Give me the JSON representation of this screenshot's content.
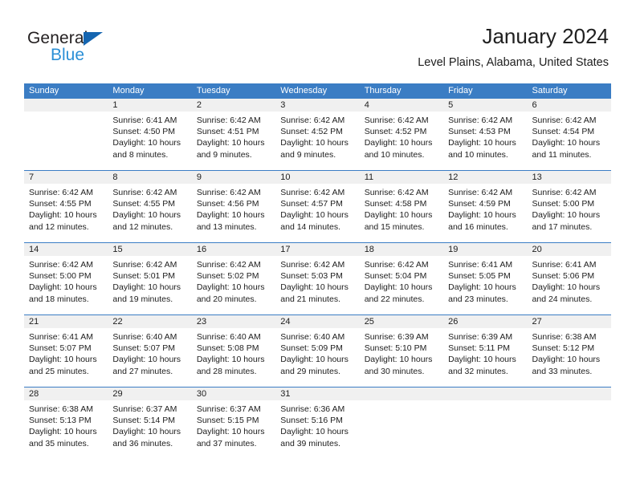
{
  "brand": {
    "name_top": "General",
    "name_bottom": "Blue",
    "accent_blue": "#1565b0",
    "light_blue": "#2b8fd6"
  },
  "header": {
    "title": "January 2024",
    "subtitle": "Level Plains, Alabama, United States"
  },
  "calendar": {
    "header_bg": "#3b7dc4",
    "daynum_bg": "#f0f0f0",
    "weekdays": [
      "Sunday",
      "Monday",
      "Tuesday",
      "Wednesday",
      "Thursday",
      "Friday",
      "Saturday"
    ],
    "weeks": [
      [
        {
          "day": "",
          "sunrise": "",
          "sunset": "",
          "daylight": "",
          "empty": true
        },
        {
          "day": "1",
          "sunrise": "Sunrise: 6:41 AM",
          "sunset": "Sunset: 4:50 PM",
          "daylight": "Daylight: 10 hours and 8 minutes."
        },
        {
          "day": "2",
          "sunrise": "Sunrise: 6:42 AM",
          "sunset": "Sunset: 4:51 PM",
          "daylight": "Daylight: 10 hours and 9 minutes."
        },
        {
          "day": "3",
          "sunrise": "Sunrise: 6:42 AM",
          "sunset": "Sunset: 4:52 PM",
          "daylight": "Daylight: 10 hours and 9 minutes."
        },
        {
          "day": "4",
          "sunrise": "Sunrise: 6:42 AM",
          "sunset": "Sunset: 4:52 PM",
          "daylight": "Daylight: 10 hours and 10 minutes."
        },
        {
          "day": "5",
          "sunrise": "Sunrise: 6:42 AM",
          "sunset": "Sunset: 4:53 PM",
          "daylight": "Daylight: 10 hours and 10 minutes."
        },
        {
          "day": "6",
          "sunrise": "Sunrise: 6:42 AM",
          "sunset": "Sunset: 4:54 PM",
          "daylight": "Daylight: 10 hours and 11 minutes."
        }
      ],
      [
        {
          "day": "7",
          "sunrise": "Sunrise: 6:42 AM",
          "sunset": "Sunset: 4:55 PM",
          "daylight": "Daylight: 10 hours and 12 minutes."
        },
        {
          "day": "8",
          "sunrise": "Sunrise: 6:42 AM",
          "sunset": "Sunset: 4:55 PM",
          "daylight": "Daylight: 10 hours and 12 minutes."
        },
        {
          "day": "9",
          "sunrise": "Sunrise: 6:42 AM",
          "sunset": "Sunset: 4:56 PM",
          "daylight": "Daylight: 10 hours and 13 minutes."
        },
        {
          "day": "10",
          "sunrise": "Sunrise: 6:42 AM",
          "sunset": "Sunset: 4:57 PM",
          "daylight": "Daylight: 10 hours and 14 minutes."
        },
        {
          "day": "11",
          "sunrise": "Sunrise: 6:42 AM",
          "sunset": "Sunset: 4:58 PM",
          "daylight": "Daylight: 10 hours and 15 minutes."
        },
        {
          "day": "12",
          "sunrise": "Sunrise: 6:42 AM",
          "sunset": "Sunset: 4:59 PM",
          "daylight": "Daylight: 10 hours and 16 minutes."
        },
        {
          "day": "13",
          "sunrise": "Sunrise: 6:42 AM",
          "sunset": "Sunset: 5:00 PM",
          "daylight": "Daylight: 10 hours and 17 minutes."
        }
      ],
      [
        {
          "day": "14",
          "sunrise": "Sunrise: 6:42 AM",
          "sunset": "Sunset: 5:00 PM",
          "daylight": "Daylight: 10 hours and 18 minutes."
        },
        {
          "day": "15",
          "sunrise": "Sunrise: 6:42 AM",
          "sunset": "Sunset: 5:01 PM",
          "daylight": "Daylight: 10 hours and 19 minutes."
        },
        {
          "day": "16",
          "sunrise": "Sunrise: 6:42 AM",
          "sunset": "Sunset: 5:02 PM",
          "daylight": "Daylight: 10 hours and 20 minutes."
        },
        {
          "day": "17",
          "sunrise": "Sunrise: 6:42 AM",
          "sunset": "Sunset: 5:03 PM",
          "daylight": "Daylight: 10 hours and 21 minutes."
        },
        {
          "day": "18",
          "sunrise": "Sunrise: 6:42 AM",
          "sunset": "Sunset: 5:04 PM",
          "daylight": "Daylight: 10 hours and 22 minutes."
        },
        {
          "day": "19",
          "sunrise": "Sunrise: 6:41 AM",
          "sunset": "Sunset: 5:05 PM",
          "daylight": "Daylight: 10 hours and 23 minutes."
        },
        {
          "day": "20",
          "sunrise": "Sunrise: 6:41 AM",
          "sunset": "Sunset: 5:06 PM",
          "daylight": "Daylight: 10 hours and 24 minutes."
        }
      ],
      [
        {
          "day": "21",
          "sunrise": "Sunrise: 6:41 AM",
          "sunset": "Sunset: 5:07 PM",
          "daylight": "Daylight: 10 hours and 25 minutes."
        },
        {
          "day": "22",
          "sunrise": "Sunrise: 6:40 AM",
          "sunset": "Sunset: 5:07 PM",
          "daylight": "Daylight: 10 hours and 27 minutes."
        },
        {
          "day": "23",
          "sunrise": "Sunrise: 6:40 AM",
          "sunset": "Sunset: 5:08 PM",
          "daylight": "Daylight: 10 hours and 28 minutes."
        },
        {
          "day": "24",
          "sunrise": "Sunrise: 6:40 AM",
          "sunset": "Sunset: 5:09 PM",
          "daylight": "Daylight: 10 hours and 29 minutes."
        },
        {
          "day": "25",
          "sunrise": "Sunrise: 6:39 AM",
          "sunset": "Sunset: 5:10 PM",
          "daylight": "Daylight: 10 hours and 30 minutes."
        },
        {
          "day": "26",
          "sunrise": "Sunrise: 6:39 AM",
          "sunset": "Sunset: 5:11 PM",
          "daylight": "Daylight: 10 hours and 32 minutes."
        },
        {
          "day": "27",
          "sunrise": "Sunrise: 6:38 AM",
          "sunset": "Sunset: 5:12 PM",
          "daylight": "Daylight: 10 hours and 33 minutes."
        }
      ],
      [
        {
          "day": "28",
          "sunrise": "Sunrise: 6:38 AM",
          "sunset": "Sunset: 5:13 PM",
          "daylight": "Daylight: 10 hours and 35 minutes."
        },
        {
          "day": "29",
          "sunrise": "Sunrise: 6:37 AM",
          "sunset": "Sunset: 5:14 PM",
          "daylight": "Daylight: 10 hours and 36 minutes."
        },
        {
          "day": "30",
          "sunrise": "Sunrise: 6:37 AM",
          "sunset": "Sunset: 5:15 PM",
          "daylight": "Daylight: 10 hours and 37 minutes."
        },
        {
          "day": "31",
          "sunrise": "Sunrise: 6:36 AM",
          "sunset": "Sunset: 5:16 PM",
          "daylight": "Daylight: 10 hours and 39 minutes."
        },
        {
          "day": "",
          "sunrise": "",
          "sunset": "",
          "daylight": "",
          "empty": true
        },
        {
          "day": "",
          "sunrise": "",
          "sunset": "",
          "daylight": "",
          "empty": true
        },
        {
          "day": "",
          "sunrise": "",
          "sunset": "",
          "daylight": "",
          "empty": true
        }
      ]
    ]
  }
}
